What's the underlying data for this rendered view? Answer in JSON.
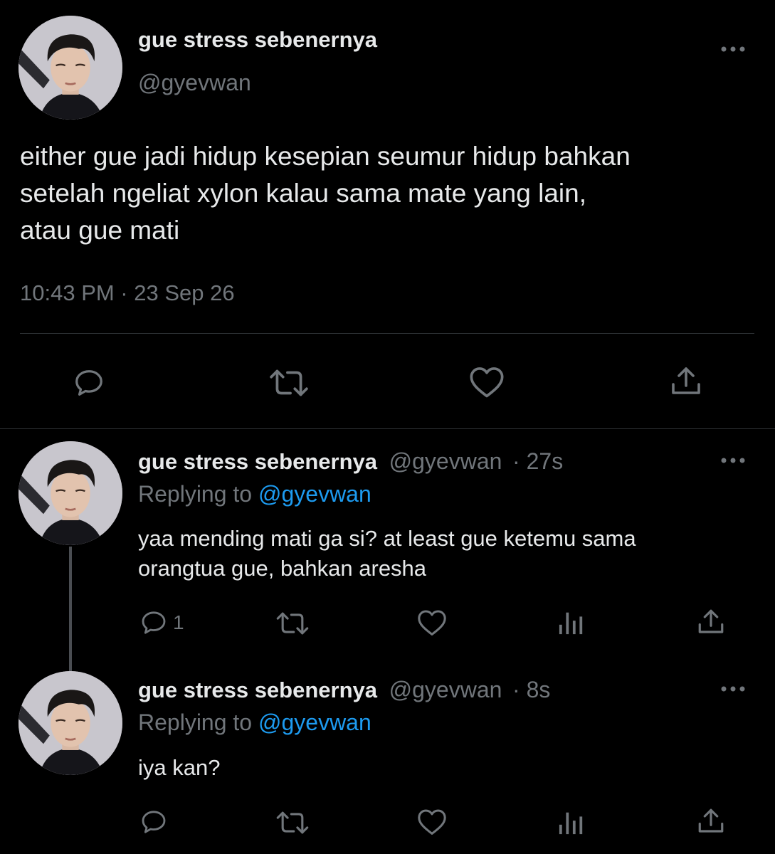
{
  "main_tweet": {
    "display_name": "gue stress sebenernya",
    "handle": "@gyevwan",
    "text": "either gue jadi hidup kesepian seumur hidup bahkan\nsetelah ngeliat xylon kalau sama mate yang lain,\natau gue mati",
    "timestamp": "10:43 PM · 23 Sep 26",
    "more_icon": "more-dots-icon"
  },
  "replies": [
    {
      "display_name": "gue stress sebenernya",
      "handle": "@gyevwan",
      "time": "· 27s",
      "replying_prefix": "Replying to",
      "replying_handle": "@gyevwan",
      "text": "yaa mending mati ga si? at least gue ketemu sama\norangtua gue, bahkan aresha",
      "reply_count": "1"
    },
    {
      "display_name": "gue stress sebenernya",
      "handle": "@gyevwan",
      "time": "· 8s",
      "replying_prefix": "Replying to",
      "replying_handle": "@gyevwan",
      "text": "iya kan?",
      "reply_count": ""
    }
  ],
  "colors": {
    "background": "#000000",
    "text": "#e7e9ea",
    "muted": "#71767b",
    "accent": "#1d9bf0",
    "divider": "#2f3336"
  }
}
